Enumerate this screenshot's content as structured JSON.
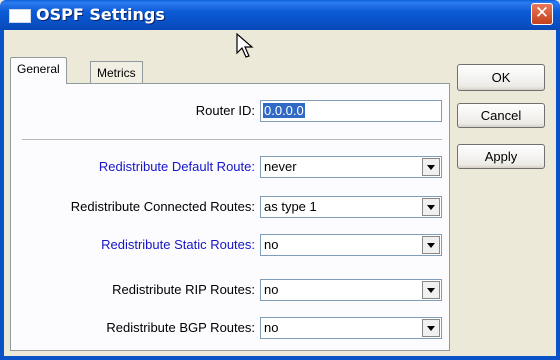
{
  "window": {
    "title": "OSPF Settings",
    "close_glyph": "✕"
  },
  "tabs": [
    {
      "label": "General",
      "active": true
    },
    {
      "label": "Metrics",
      "active": false
    }
  ],
  "fields": {
    "router_id": {
      "label": "Router ID:",
      "value": "0.0.0.0"
    },
    "default_route": {
      "label": "Redistribute Default Route:",
      "value": "never"
    },
    "connected_routes": {
      "label": "Redistribute Connected Routes:",
      "value": "as type 1"
    },
    "static_routes": {
      "label": "Redistribute Static Routes:",
      "value": "no"
    },
    "rip_routes": {
      "label": "Redistribute RIP Routes:",
      "value": "no"
    },
    "bgp_routes": {
      "label": "Redistribute BGP Routes:",
      "value": "no"
    }
  },
  "buttons": {
    "ok": "OK",
    "cancel": "Cancel",
    "apply": "Apply"
  },
  "colors": {
    "title_bar": "#0a52c8",
    "highlight_label": "#1515c9",
    "selection": "#316ac5"
  }
}
